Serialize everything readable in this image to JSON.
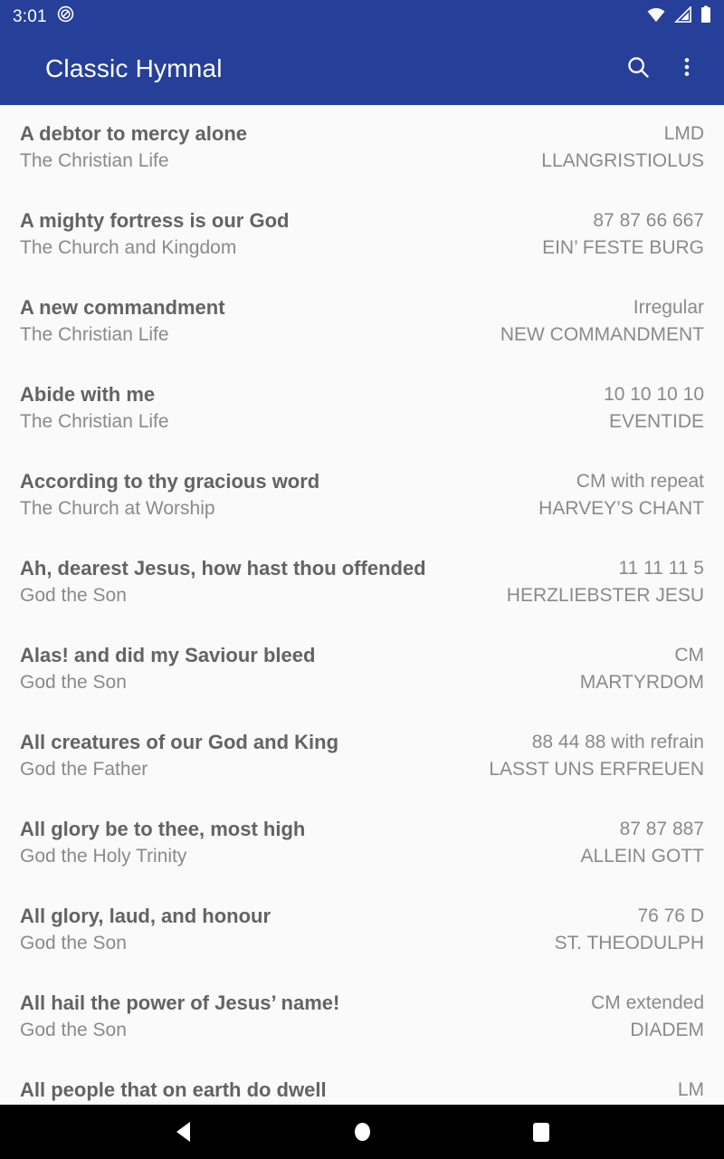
{
  "status_bar": {
    "clock": "3:01",
    "icons": {
      "notification": "do-not-disturb-icon",
      "wifi": "wifi-icon",
      "signal": "cell-signal-icon",
      "battery": "battery-full-icon"
    }
  },
  "app_bar": {
    "title": "Classic Hymnal",
    "search_label": "search-icon",
    "overflow_label": "more-options-icon"
  },
  "hymns": [
    {
      "title": "A debtor to mercy alone",
      "section": "The Christian Life",
      "meter": "LMD",
      "tune": "LLANGRISTIOLUS"
    },
    {
      "title": "A mighty fortress is our God",
      "section": "The Church and Kingdom",
      "meter": "87 87 66 667",
      "tune": "EIN’ FESTE BURG"
    },
    {
      "title": "A new commandment",
      "section": "The Christian Life",
      "meter": "Irregular",
      "tune": "NEW COMMANDMENT"
    },
    {
      "title": "Abide with me",
      "section": "The Christian Life",
      "meter": "10 10 10 10",
      "tune": "EVENTIDE"
    },
    {
      "title": "According to thy gracious word",
      "section": "The Church at Worship",
      "meter": "CM with repeat",
      "tune": "HARVEY’S CHANT"
    },
    {
      "title": "Ah, dearest Jesus, how hast thou offended",
      "section": "God the Son",
      "meter": "11 11 11 5",
      "tune": "HERZLIEBSTER JESU"
    },
    {
      "title": "Alas! and did my Saviour bleed",
      "section": "God the Son",
      "meter": "CM",
      "tune": "MARTYRDOM"
    },
    {
      "title": "All creatures of our God and King",
      "section": "God the Father",
      "meter": "88 44 88 with refrain",
      "tune": "LASST UNS ERFREUEN"
    },
    {
      "title": "All glory be to thee, most high",
      "section": "God the Holy Trinity",
      "meter": "87 87 887",
      "tune": "ALLEIN GOTT"
    },
    {
      "title": "All glory, laud, and honour",
      "section": "God the Son",
      "meter": "76 76 D",
      "tune": "ST. THEODULPH"
    },
    {
      "title": "All hail the power of Jesus’ name!",
      "section": "God the Son",
      "meter": "CM extended",
      "tune": "DIADEM"
    },
    {
      "title": "All people that on earth do dwell",
      "section": "",
      "meter": "LM",
      "tune": ""
    }
  ],
  "nav_bar": {
    "back": "back-icon",
    "home": "home-icon",
    "recents": "recents-icon"
  },
  "colors": {
    "primary": "#26409a",
    "background": "#fafafa",
    "title_text": "#636363",
    "secondary_text": "#8a8a8a"
  }
}
